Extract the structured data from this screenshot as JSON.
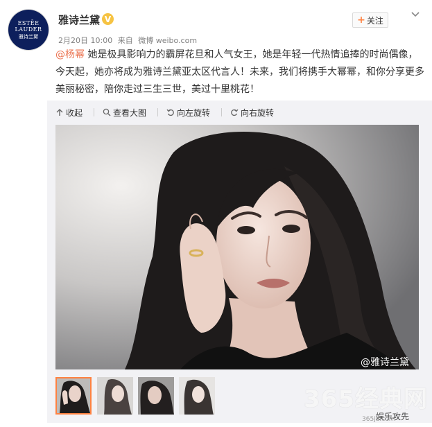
{
  "account": {
    "avatar_line1": "ESTĒE",
    "avatar_line2": "LAUDER",
    "avatar_line3": "雅诗兰黛",
    "name": "雅诗兰黛",
    "verified_badge": "V"
  },
  "actions": {
    "follow_plus": "+",
    "follow_label": "关注"
  },
  "meta": {
    "date": "2月20日 10:00",
    "from": "来自",
    "source": "微博 weibo.com"
  },
  "post": {
    "mention": "@杨幂",
    "text": " 她是极具影响力的霸屏花旦和人气女王，她是年轻一代热情追捧的时尚偶像，今天起，她亦将成为雅诗兰黛亚太区代言人！未来，我们将携手大幂幂，和你分享更多美丽秘密，陪你走过三生三世，美过十里桃花！"
  },
  "toolbar": {
    "collapse": "收起",
    "view_large": "查看大图",
    "rotate_left": "向左旋转",
    "rotate_right": "向右旋转"
  },
  "photo": {
    "handle": "@雅诗兰黛"
  },
  "thumbnails": {
    "count": 4,
    "selected_index": 0
  },
  "watermark": {
    "site": "365经典网",
    "sub": "娱乐攻先",
    "url": "365jd.com"
  },
  "colors": {
    "mention": "#eb7350",
    "follow_plus": "#ff8140",
    "badge": "#f6c343",
    "panel": "#f2f2f5",
    "avatar": "#0d1f5c"
  },
  "icons": [
    "chevron-down-icon",
    "collapse-arrow-icon",
    "magnifier-icon",
    "rotate-left-icon",
    "rotate-right-icon"
  ]
}
